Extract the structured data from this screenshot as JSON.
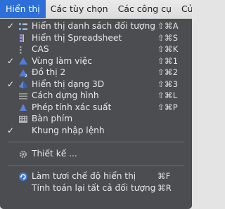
{
  "menubar": {
    "menus": [
      "Hiển thị",
      "Các tùy chọn",
      "Các công cụ",
      "Cử"
    ]
  },
  "menu": {
    "items": [
      {
        "label": "Hiển thị danh sách đối tượng",
        "shortcut": "⇧⌘A",
        "checked": true,
        "icon": "algebra-view-icon"
      },
      {
        "label": "Hiển thị Spreadsheet",
        "shortcut": "⇧⌘S",
        "checked": false,
        "icon": "spreadsheet-icon"
      },
      {
        "label": "CAS",
        "shortcut": "⇧⌘K",
        "checked": false,
        "icon": "cas-icon"
      },
      {
        "label": "Vùng làm việc",
        "shortcut": "⇧⌘1",
        "checked": true,
        "icon": "graphics-view-icon"
      },
      {
        "label": "Đồ thị 2",
        "shortcut": "⇧⌘2",
        "checked": false,
        "icon": "graphics-2-icon"
      },
      {
        "label": "Hiển thị dạng 3D",
        "shortcut": "⇧⌘3",
        "checked": true,
        "icon": "graphics-3d-icon"
      },
      {
        "label": "Cách dựng hình",
        "shortcut": "⇧⌘L",
        "checked": false,
        "icon": "construction-protocol-icon"
      },
      {
        "label": "Phép tính xác suất",
        "shortcut": "⇧⌘P",
        "checked": false,
        "icon": "probability-calculator-icon"
      },
      {
        "label": "Bàn phím",
        "shortcut": "",
        "checked": false,
        "icon": "keyboard-icon"
      },
      {
        "label": "Khung nhập lệnh",
        "shortcut": "",
        "checked": true,
        "icon": ""
      },
      {
        "label": "Thiết kế ...",
        "shortcut": "",
        "checked": false,
        "icon": "gear-icon"
      },
      {
        "label": "Làm tươi chế độ hiển thị",
        "shortcut": "⌘F",
        "checked": false,
        "icon": "refresh-icon"
      },
      {
        "label": "Tính toán lại tất cả đối tượng",
        "shortcut": "⌘R",
        "checked": false,
        "icon": ""
      }
    ]
  },
  "colors": {
    "menubar_bg": "#dcdcdc",
    "active_menu": "#2d6fd9",
    "dropdown_bg": "#4c4d50",
    "text": "#e9e9ea"
  }
}
